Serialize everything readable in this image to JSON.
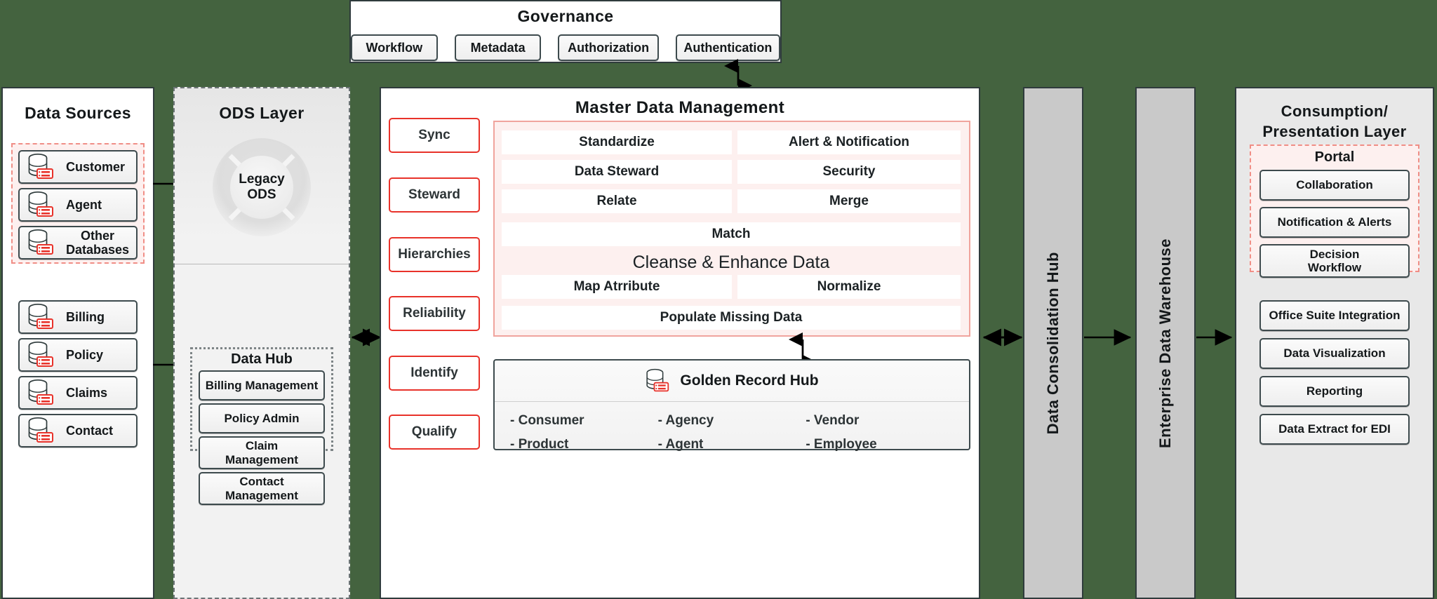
{
  "canvas": {
    "background": "#44633f"
  },
  "governance": {
    "title": "Governance",
    "items": [
      "Workflow",
      "Metadata",
      "Authorization",
      "Authentication"
    ]
  },
  "data_sources": {
    "title": "Data Sources",
    "highlighted_group": [
      "Customer",
      "Agent",
      "Other Databases"
    ],
    "other_group": [
      "Billing",
      "Policy",
      "Claims",
      "Contact"
    ],
    "icon": "database-icon"
  },
  "ods_layer": {
    "title": "ODS Layer",
    "legacy_label_line1": "Legacy",
    "legacy_label_line2": "ODS",
    "data_hub": {
      "title": "Data Hub",
      "items": [
        "Billing Management",
        "Policy Admin",
        "Claim Management",
        "Contact Management"
      ]
    }
  },
  "mdm": {
    "title": "Master Data Management",
    "rail": [
      "Sync",
      "Steward",
      "Hierarchies",
      "Reliability",
      "Identify",
      "Qualify"
    ],
    "capabilities": {
      "row1": [
        "Standardize",
        "Alert & Notification"
      ],
      "row2": [
        "Data Steward",
        "Security"
      ],
      "row3": [
        "Relate",
        "Merge"
      ],
      "full1": "Match",
      "section_label": "Cleanse & Enhance Data",
      "row4": [
        "Map Atrribute",
        "Normalize"
      ],
      "full2": "Populate Missing Data"
    },
    "golden_record_hub": {
      "title": "Golden Record Hub",
      "icon": "database-icon",
      "entities": [
        "- Consumer",
        "- Agency",
        "- Vendor",
        "- Product",
        "- Agent",
        "- Employee"
      ]
    }
  },
  "pipeline": {
    "consolidation_hub": "Data Consolidation Hub",
    "enterprise_warehouse": "Enterprise Data Warehouse"
  },
  "consumption": {
    "title_line1": "Consumption/",
    "title_line2": "Presentation Layer",
    "portal": {
      "title": "Portal",
      "items": [
        "Collaboration",
        "Notification & Alerts",
        "Decision Workflow"
      ]
    },
    "services": [
      "Office Suite Integration",
      "Data Visualization",
      "Reporting",
      "Data Extract for EDI"
    ]
  },
  "colors": {
    "canvas_green": "#44633f",
    "accent_red": "#e8322a",
    "pink_fill": "#fdf0ef",
    "slab_gray": "#c9c9c9",
    "border_dark": "#2f3b3c"
  }
}
